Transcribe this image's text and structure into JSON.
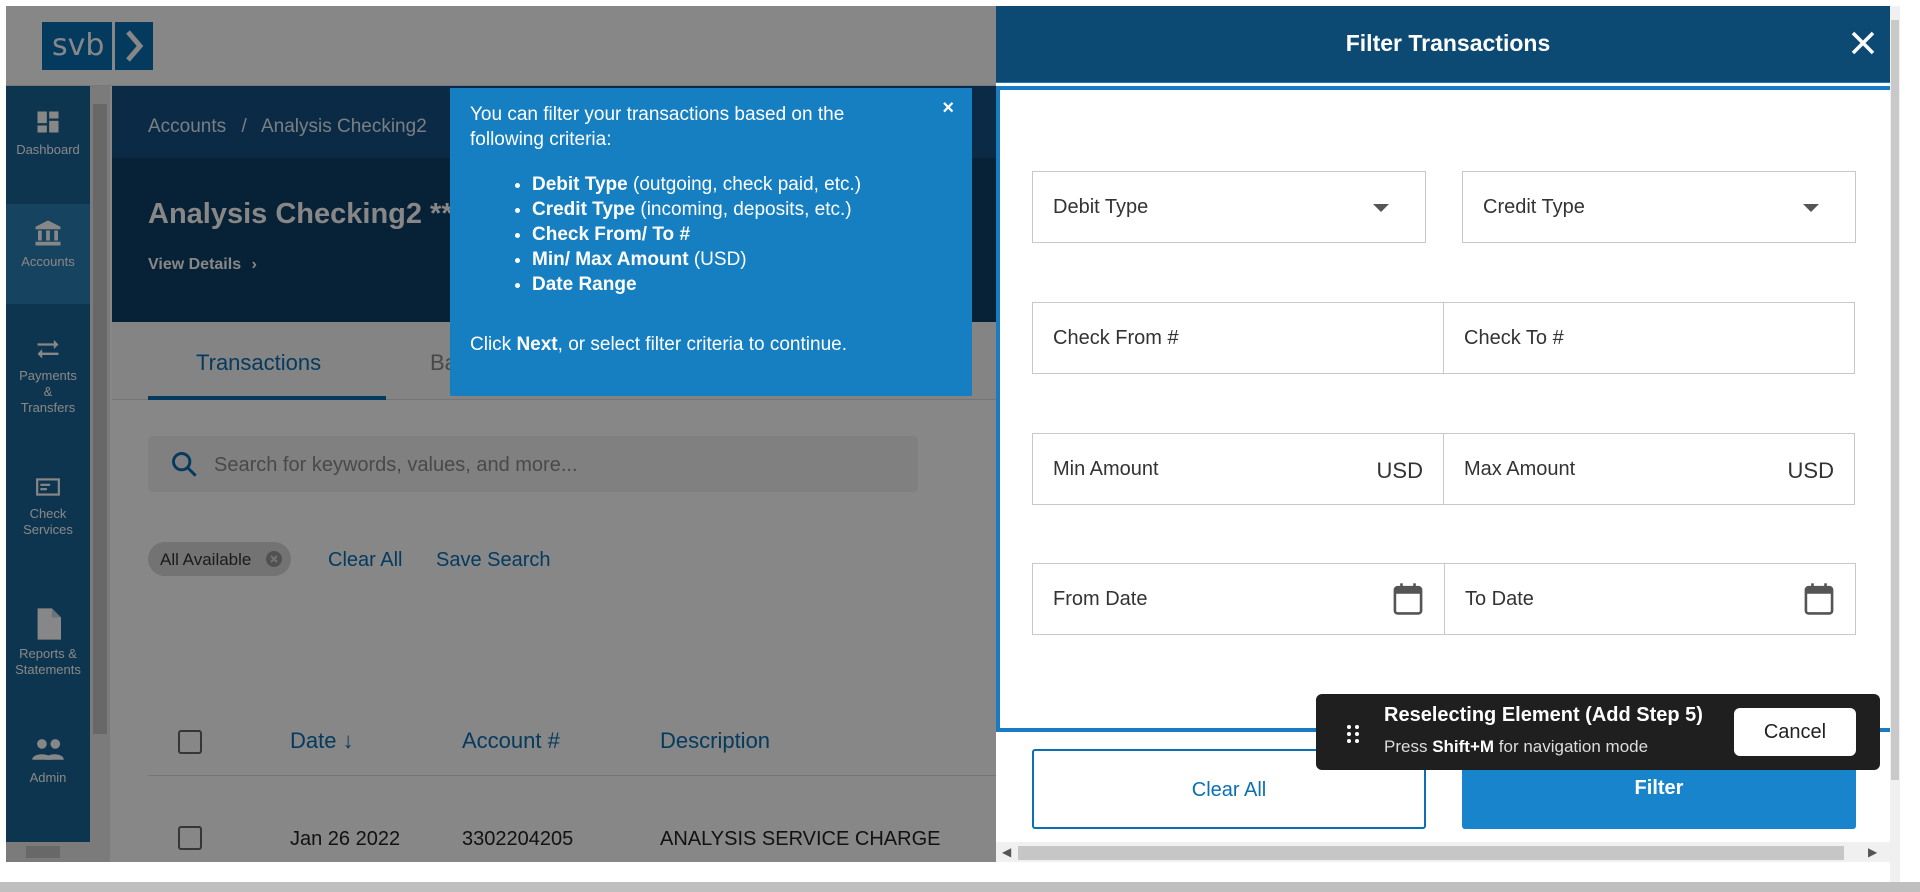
{
  "app": {
    "logo_text": "svb",
    "breadcrumb": {
      "root": "Accounts",
      "separator": "/",
      "current": "Analysis Checking2"
    },
    "account_title": "Analysis Checking2 **",
    "view_details": "View Details",
    "tabs": [
      {
        "label": "Transactions"
      },
      {
        "label": "Ba"
      }
    ],
    "search_placeholder": "Search for keywords, values, and more...",
    "chip_label": "All Available",
    "clear_all_link": "Clear All",
    "save_search_link": "Save Search",
    "table": {
      "columns": [
        {
          "label": "Date"
        },
        {
          "label": "Account #"
        },
        {
          "label": "Description"
        }
      ],
      "rows": [
        {
          "date": "Jan 26 2022",
          "account": "3302204205",
          "description": "ANALYSIS SERVICE CHARGE"
        }
      ]
    }
  },
  "sidebar": {
    "items": [
      {
        "label": "Dashboard",
        "icon": "dashboard-icon"
      },
      {
        "label": "Accounts",
        "icon": "bank-icon"
      },
      {
        "label": "Payments & Transfers",
        "icon": "transfer-icon"
      },
      {
        "label": "Check Services",
        "icon": "check-icon"
      },
      {
        "label": "Reports & Statements",
        "icon": "document-icon"
      },
      {
        "label": "Admin",
        "icon": "people-icon"
      }
    ],
    "payments_lines": [
      "Payments",
      "&",
      "Transfers"
    ],
    "check_lines": [
      "Check",
      "Services"
    ],
    "reports_lines": [
      "Reports &",
      "Statements"
    ]
  },
  "tooltip": {
    "intro": "You can filter your transactions based on the following criteria:",
    "criteria": [
      {
        "bold": "Debit Type",
        "rest": " (outgoing, check paid, etc.)"
      },
      {
        "bold": "Credit Type",
        "rest": " (incoming, deposits, etc.)"
      },
      {
        "bold": "Check From/ To #",
        "rest": ""
      },
      {
        "bold": "Min/ Max Amount",
        "rest": " (USD)"
      },
      {
        "bold": "Date Range",
        "rest": ""
      }
    ],
    "footer_pre": "Click ",
    "footer_bold": "Next",
    "footer_post": ", or select filter criteria to continue.",
    "close": "×"
  },
  "filter_panel": {
    "title": "Filter Transactions",
    "debit_type": "Debit Type",
    "credit_type": "Credit Type",
    "check_from": "Check From #",
    "check_to": "Check To #",
    "min_amount": "Min Amount",
    "max_amount": "Max Amount",
    "currency": "USD",
    "from_date": "From Date",
    "to_date": "To Date",
    "clear_all": "Clear All",
    "filter": "Filter"
  },
  "toast": {
    "title": "Reselecting Element (Add Step 5)",
    "hint_pre": "Press ",
    "hint_key": "Shift+M",
    "hint_post": " for navigation mode",
    "cancel": "Cancel"
  },
  "colors": {
    "brand": "#0a6fb3",
    "sidebar": "#1c6595",
    "panel_header": "#0c4a74",
    "tooltip": "#167fc2",
    "filter_button": "#1784cc"
  }
}
